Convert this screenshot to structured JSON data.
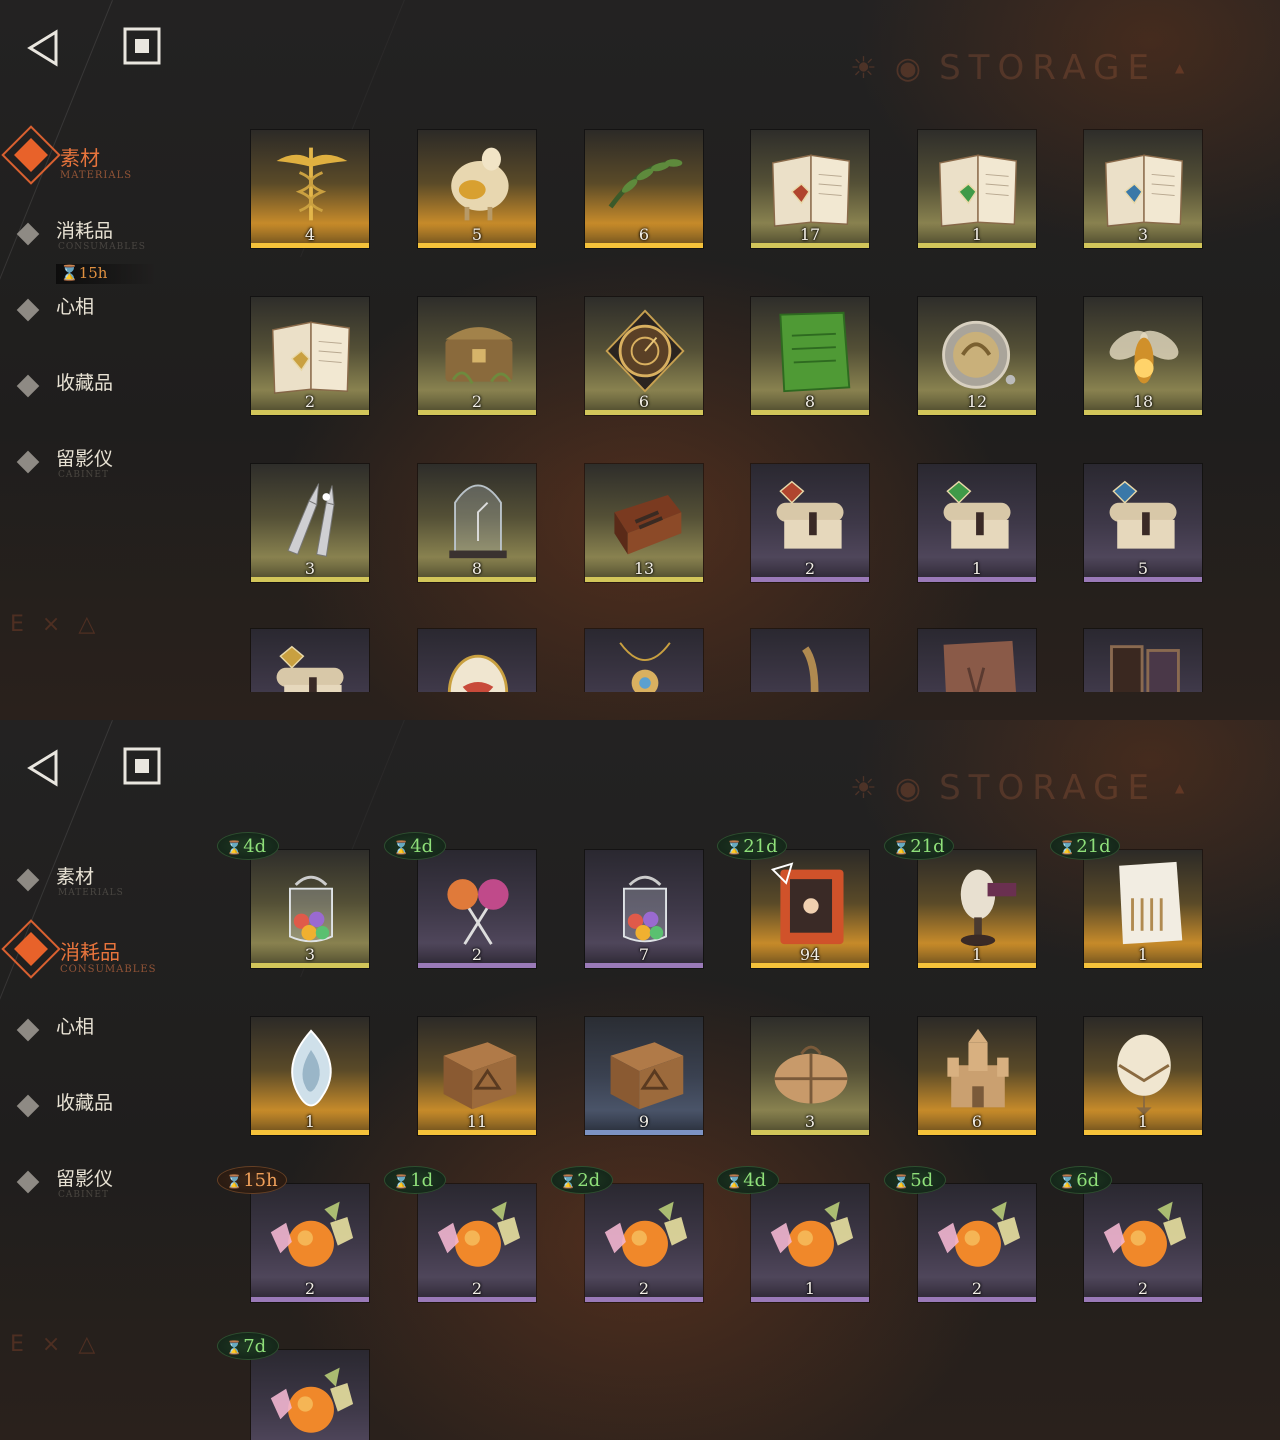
{
  "page": {
    "storage_label": "STORAGE",
    "back_icon": "back-triangle-icon",
    "menu_icon": "square-menu-icon"
  },
  "panel1": {
    "categories": [
      {
        "label": "素材",
        "sub": "MATERIALS",
        "active": true
      },
      {
        "label": "消耗品",
        "sub": "CONSUMABLES",
        "active": false,
        "timer": "15h"
      },
      {
        "label": "心相",
        "sub": "",
        "active": false
      },
      {
        "label": "收藏品",
        "sub": "",
        "active": false
      },
      {
        "label": "留影仪",
        "sub": "CABINET",
        "active": false
      }
    ],
    "rows": [
      [
        {
          "icon": "caduceus-icon",
          "count": "4",
          "rarity": "gold"
        },
        {
          "icon": "sheep-icon",
          "count": "5",
          "rarity": "gold"
        },
        {
          "icon": "laurel-wreath-icon",
          "count": "6",
          "rarity": "gold"
        },
        {
          "icon": "red-book-icon",
          "count": "17",
          "rarity": "yellow"
        },
        {
          "icon": "green-book-icon",
          "count": "1",
          "rarity": "yellow"
        },
        {
          "icon": "blue-book-icon",
          "count": "3",
          "rarity": "yellow"
        }
      ],
      [
        {
          "icon": "gold-book-icon",
          "count": "2",
          "rarity": "yellow"
        },
        {
          "icon": "treasure-chest-icon",
          "count": "2",
          "rarity": "yellow"
        },
        {
          "icon": "astrolabe-icon",
          "count": "6",
          "rarity": "yellow"
        },
        {
          "icon": "green-tablet-icon",
          "count": "8",
          "rarity": "yellow"
        },
        {
          "icon": "pocket-watch-icon",
          "count": "12",
          "rarity": "yellow"
        },
        {
          "icon": "firefly-icon",
          "count": "18",
          "rarity": "yellow"
        }
      ],
      [
        {
          "icon": "bullets-icon",
          "count": "3",
          "rarity": "yellow"
        },
        {
          "icon": "bell-jar-icon",
          "count": "8",
          "rarity": "yellow"
        },
        {
          "icon": "hand-box-icon",
          "count": "13",
          "rarity": "yellow"
        },
        {
          "icon": "red-scroll-icon",
          "count": "2",
          "rarity": "purple"
        },
        {
          "icon": "green-scroll-icon",
          "count": "1",
          "rarity": "purple"
        },
        {
          "icon": "blue-scroll-icon",
          "count": "5",
          "rarity": "purple"
        }
      ],
      [
        {
          "icon": "gold-scroll-icon",
          "count": "",
          "rarity": "purple"
        },
        {
          "icon": "egg-icon",
          "count": "",
          "rarity": "purple"
        },
        {
          "icon": "amulet-icon",
          "count": "",
          "rarity": "purple"
        },
        {
          "icon": "bracelet-icon",
          "count": "",
          "rarity": "purple"
        },
        {
          "icon": "stone-slab-icon",
          "count": "",
          "rarity": "purple"
        },
        {
          "icon": "mirror-frame-icon",
          "count": "",
          "rarity": "purple"
        }
      ]
    ]
  },
  "panel2": {
    "categories": [
      {
        "label": "素材",
        "sub": "MATERIALS",
        "active": false
      },
      {
        "label": "消耗品",
        "sub": "CONSUMABLES",
        "active": true
      },
      {
        "label": "心相",
        "sub": "",
        "active": false
      },
      {
        "label": "收藏品",
        "sub": "",
        "active": false
      },
      {
        "label": "留影仪",
        "sub": "CABINET",
        "active": false
      }
    ],
    "rows": [
      [
        {
          "icon": "candy-jar-icon",
          "count": "3",
          "rarity": "yellow",
          "timer": "4d",
          "timer_color": "green"
        },
        {
          "icon": "lollipop-icon",
          "count": "2",
          "rarity": "purple",
          "timer": "4d",
          "timer_color": "green"
        },
        {
          "icon": "candy-jar-icon",
          "count": "7",
          "rarity": "purple",
          "timer": "",
          "timer_color": ""
        },
        {
          "icon": "orange-book-icon",
          "count": "94",
          "rarity": "gold",
          "timer": "21d",
          "timer_color": "green"
        },
        {
          "icon": "mannequin-icon",
          "count": "1",
          "rarity": "gold",
          "timer": "21d",
          "timer_color": "green"
        },
        {
          "icon": "shopping-list-icon",
          "count": "1",
          "rarity": "gold",
          "timer": "21d",
          "timer_color": "green"
        }
      ],
      [
        {
          "icon": "silver-flame-icon",
          "count": "1",
          "rarity": "gold",
          "timer": "",
          "timer_color": ""
        },
        {
          "icon": "wooden-crate-icon",
          "count": "11",
          "rarity": "gold",
          "timer": "",
          "timer_color": ""
        },
        {
          "icon": "wooden-crate-icon",
          "count": "9",
          "rarity": "blue",
          "timer": "",
          "timer_color": ""
        },
        {
          "icon": "parcel-icon",
          "count": "3",
          "rarity": "yellow",
          "timer": "",
          "timer_color": ""
        },
        {
          "icon": "sand-castle-icon",
          "count": "6",
          "rarity": "gold",
          "timer": "",
          "timer_color": ""
        },
        {
          "icon": "balloon-icon",
          "count": "1",
          "rarity": "gold",
          "timer": "",
          "timer_color": ""
        }
      ],
      [
        {
          "icon": "candies-icon",
          "count": "2",
          "rarity": "purple",
          "timer": "15h",
          "timer_color": "orange"
        },
        {
          "icon": "candies-icon",
          "count": "2",
          "rarity": "purple",
          "timer": "1d",
          "timer_color": "green"
        },
        {
          "icon": "candies-icon",
          "count": "2",
          "rarity": "purple",
          "timer": "2d",
          "timer_color": "green"
        },
        {
          "icon": "candies-icon",
          "count": "1",
          "rarity": "purple",
          "timer": "4d",
          "timer_color": "green"
        },
        {
          "icon": "candies-icon",
          "count": "2",
          "rarity": "purple",
          "timer": "5d",
          "timer_color": "green"
        },
        {
          "icon": "candies-icon",
          "count": "2",
          "rarity": "purple",
          "timer": "6d",
          "timer_color": "green"
        }
      ],
      [
        {
          "icon": "candies-icon",
          "count": "",
          "rarity": "purple",
          "timer": "7d",
          "timer_color": "green"
        }
      ]
    ]
  },
  "colors": {
    "accent": "#e8622a",
    "timer_green": "#8fe07a",
    "timer_orange": "#f0a05a",
    "gold": "#f5c23a",
    "purple": "#9a7ab8"
  }
}
